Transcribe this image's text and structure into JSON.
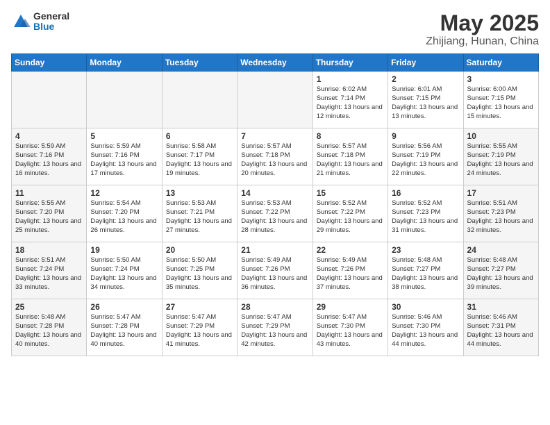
{
  "header": {
    "logo_general": "General",
    "logo_blue": "Blue",
    "month": "May 2025",
    "location": "Zhijiang, Hunan, China"
  },
  "weekdays": [
    "Sunday",
    "Monday",
    "Tuesday",
    "Wednesday",
    "Thursday",
    "Friday",
    "Saturday"
  ],
  "weeks": [
    [
      {
        "day": "",
        "info": "",
        "empty": true
      },
      {
        "day": "",
        "info": "",
        "empty": true
      },
      {
        "day": "",
        "info": "",
        "empty": true
      },
      {
        "day": "",
        "info": "",
        "empty": true
      },
      {
        "day": "1",
        "info": "Sunrise: 6:02 AM\nSunset: 7:14 PM\nDaylight: 13 hours\nand 12 minutes."
      },
      {
        "day": "2",
        "info": "Sunrise: 6:01 AM\nSunset: 7:15 PM\nDaylight: 13 hours\nand 13 minutes."
      },
      {
        "day": "3",
        "info": "Sunrise: 6:00 AM\nSunset: 7:15 PM\nDaylight: 13 hours\nand 15 minutes."
      }
    ],
    [
      {
        "day": "4",
        "info": "Sunrise: 5:59 AM\nSunset: 7:16 PM\nDaylight: 13 hours\nand 16 minutes.",
        "shaded": true
      },
      {
        "day": "5",
        "info": "Sunrise: 5:59 AM\nSunset: 7:16 PM\nDaylight: 13 hours\nand 17 minutes."
      },
      {
        "day": "6",
        "info": "Sunrise: 5:58 AM\nSunset: 7:17 PM\nDaylight: 13 hours\nand 19 minutes."
      },
      {
        "day": "7",
        "info": "Sunrise: 5:57 AM\nSunset: 7:18 PM\nDaylight: 13 hours\nand 20 minutes."
      },
      {
        "day": "8",
        "info": "Sunrise: 5:57 AM\nSunset: 7:18 PM\nDaylight: 13 hours\nand 21 minutes."
      },
      {
        "day": "9",
        "info": "Sunrise: 5:56 AM\nSunset: 7:19 PM\nDaylight: 13 hours\nand 22 minutes."
      },
      {
        "day": "10",
        "info": "Sunrise: 5:55 AM\nSunset: 7:19 PM\nDaylight: 13 hours\nand 24 minutes.",
        "shaded": true
      }
    ],
    [
      {
        "day": "11",
        "info": "Sunrise: 5:55 AM\nSunset: 7:20 PM\nDaylight: 13 hours\nand 25 minutes.",
        "shaded": true
      },
      {
        "day": "12",
        "info": "Sunrise: 5:54 AM\nSunset: 7:20 PM\nDaylight: 13 hours\nand 26 minutes."
      },
      {
        "day": "13",
        "info": "Sunrise: 5:53 AM\nSunset: 7:21 PM\nDaylight: 13 hours\nand 27 minutes."
      },
      {
        "day": "14",
        "info": "Sunrise: 5:53 AM\nSunset: 7:22 PM\nDaylight: 13 hours\nand 28 minutes."
      },
      {
        "day": "15",
        "info": "Sunrise: 5:52 AM\nSunset: 7:22 PM\nDaylight: 13 hours\nand 29 minutes."
      },
      {
        "day": "16",
        "info": "Sunrise: 5:52 AM\nSunset: 7:23 PM\nDaylight: 13 hours\nand 31 minutes."
      },
      {
        "day": "17",
        "info": "Sunrise: 5:51 AM\nSunset: 7:23 PM\nDaylight: 13 hours\nand 32 minutes.",
        "shaded": true
      }
    ],
    [
      {
        "day": "18",
        "info": "Sunrise: 5:51 AM\nSunset: 7:24 PM\nDaylight: 13 hours\nand 33 minutes.",
        "shaded": true
      },
      {
        "day": "19",
        "info": "Sunrise: 5:50 AM\nSunset: 7:24 PM\nDaylight: 13 hours\nand 34 minutes."
      },
      {
        "day": "20",
        "info": "Sunrise: 5:50 AM\nSunset: 7:25 PM\nDaylight: 13 hours\nand 35 minutes."
      },
      {
        "day": "21",
        "info": "Sunrise: 5:49 AM\nSunset: 7:26 PM\nDaylight: 13 hours\nand 36 minutes."
      },
      {
        "day": "22",
        "info": "Sunrise: 5:49 AM\nSunset: 7:26 PM\nDaylight: 13 hours\nand 37 minutes."
      },
      {
        "day": "23",
        "info": "Sunrise: 5:48 AM\nSunset: 7:27 PM\nDaylight: 13 hours\nand 38 minutes."
      },
      {
        "day": "24",
        "info": "Sunrise: 5:48 AM\nSunset: 7:27 PM\nDaylight: 13 hours\nand 39 minutes.",
        "shaded": true
      }
    ],
    [
      {
        "day": "25",
        "info": "Sunrise: 5:48 AM\nSunset: 7:28 PM\nDaylight: 13 hours\nand 40 minutes.",
        "shaded": true
      },
      {
        "day": "26",
        "info": "Sunrise: 5:47 AM\nSunset: 7:28 PM\nDaylight: 13 hours\nand 40 minutes."
      },
      {
        "day": "27",
        "info": "Sunrise: 5:47 AM\nSunset: 7:29 PM\nDaylight: 13 hours\nand 41 minutes."
      },
      {
        "day": "28",
        "info": "Sunrise: 5:47 AM\nSunset: 7:29 PM\nDaylight: 13 hours\nand 42 minutes."
      },
      {
        "day": "29",
        "info": "Sunrise: 5:47 AM\nSunset: 7:30 PM\nDaylight: 13 hours\nand 43 minutes."
      },
      {
        "day": "30",
        "info": "Sunrise: 5:46 AM\nSunset: 7:30 PM\nDaylight: 13 hours\nand 44 minutes."
      },
      {
        "day": "31",
        "info": "Sunrise: 5:46 AM\nSunset: 7:31 PM\nDaylight: 13 hours\nand 44 minutes.",
        "shaded": true
      }
    ]
  ]
}
